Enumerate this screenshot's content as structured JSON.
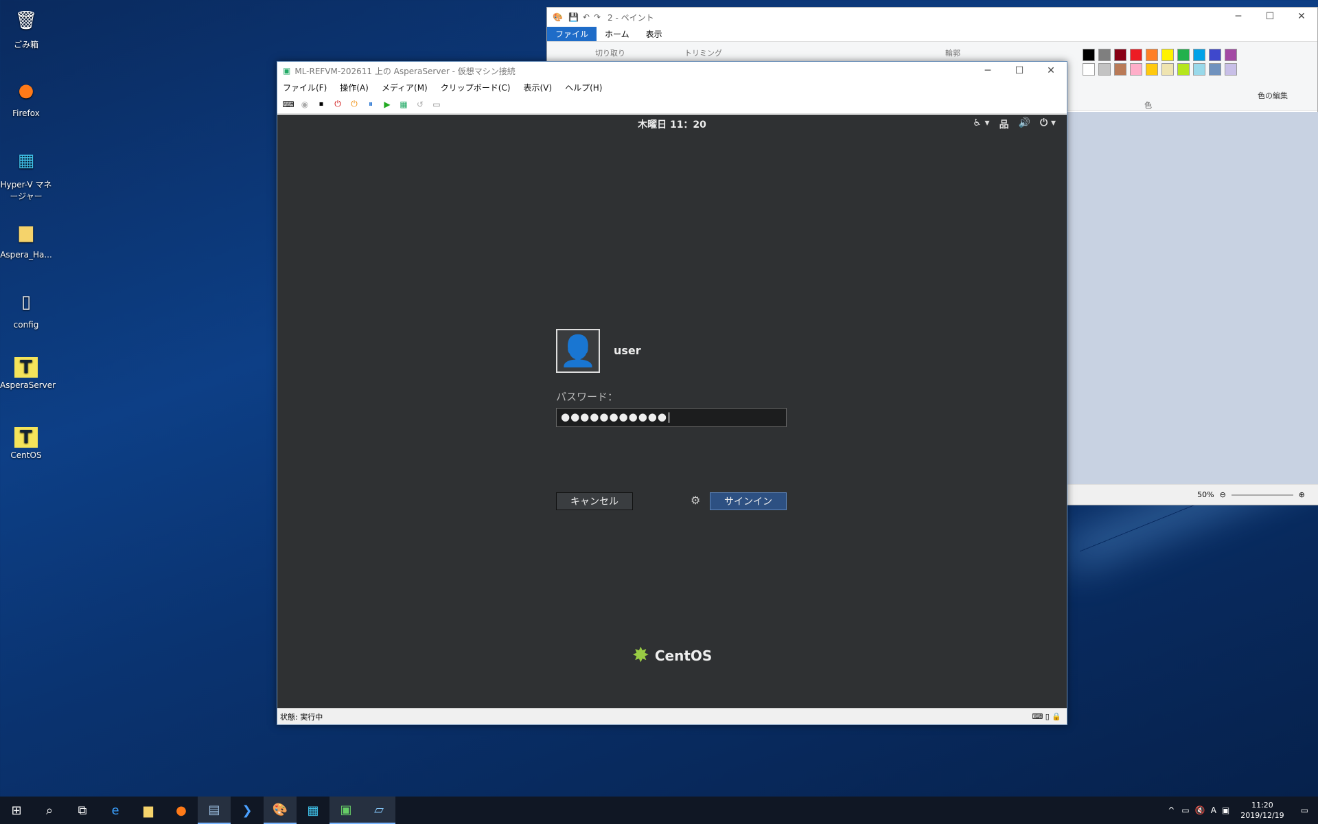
{
  "desktop": {
    "icons": [
      {
        "label": "ごみ箱",
        "glyph": "🗑"
      },
      {
        "label": "Firefox",
        "glyph": "🦊"
      },
      {
        "label": "Hyper-V マネージャー",
        "glyph": "▦"
      },
      {
        "label": "Aspera_Ha...",
        "glyph": "📁"
      },
      {
        "label": "config",
        "glyph": "📄"
      },
      {
        "label": "AsperaServer",
        "glyph": "T"
      },
      {
        "label": "CentOS",
        "glyph": "T"
      }
    ]
  },
  "paint": {
    "title": "2 - ペイント",
    "tabs": [
      "ファイル",
      "ホーム",
      "表示"
    ],
    "cut": "切り取り",
    "trim": "トリミング",
    "outline": "輪郭",
    "color_edit": "色の編集",
    "colors_group": "色",
    "zoom": "50%",
    "palette": [
      "#000000",
      "#7f7f7f",
      "#880015",
      "#ed1c24",
      "#ff7f27",
      "#fff200",
      "#22b14c",
      "#00a2e8",
      "#3f48cc",
      "#a349a4",
      "#ffffff",
      "#c3c3c3",
      "#b97a57",
      "#ffaec9",
      "#ffc90e",
      "#efe4b0",
      "#b5e61d",
      "#99d9ea",
      "#7092be",
      "#c8bfe7"
    ]
  },
  "vm": {
    "title": "ML-REFVM-202611 上の AsperaServer - 仮想マシン接続",
    "menu": [
      "ファイル(F)",
      "操作(A)",
      "メディア(M)",
      "クリップボード(C)",
      "表示(V)",
      "ヘルプ(H)"
    ],
    "status": "状態: 実行中"
  },
  "gnome": {
    "clock": "木曜日 11：20",
    "username": "user",
    "password_label": "パスワード：",
    "password_value": "●●●●●●●●●●●|",
    "cancel": "キャンセル",
    "signin": "サインイン",
    "logo": "CentOS"
  },
  "taskbar": {
    "time": "11:20",
    "date": "2019/12/19",
    "ime": "A"
  },
  "colors": {
    "accent": "#1e6cc8",
    "signin": "#2d5082"
  }
}
